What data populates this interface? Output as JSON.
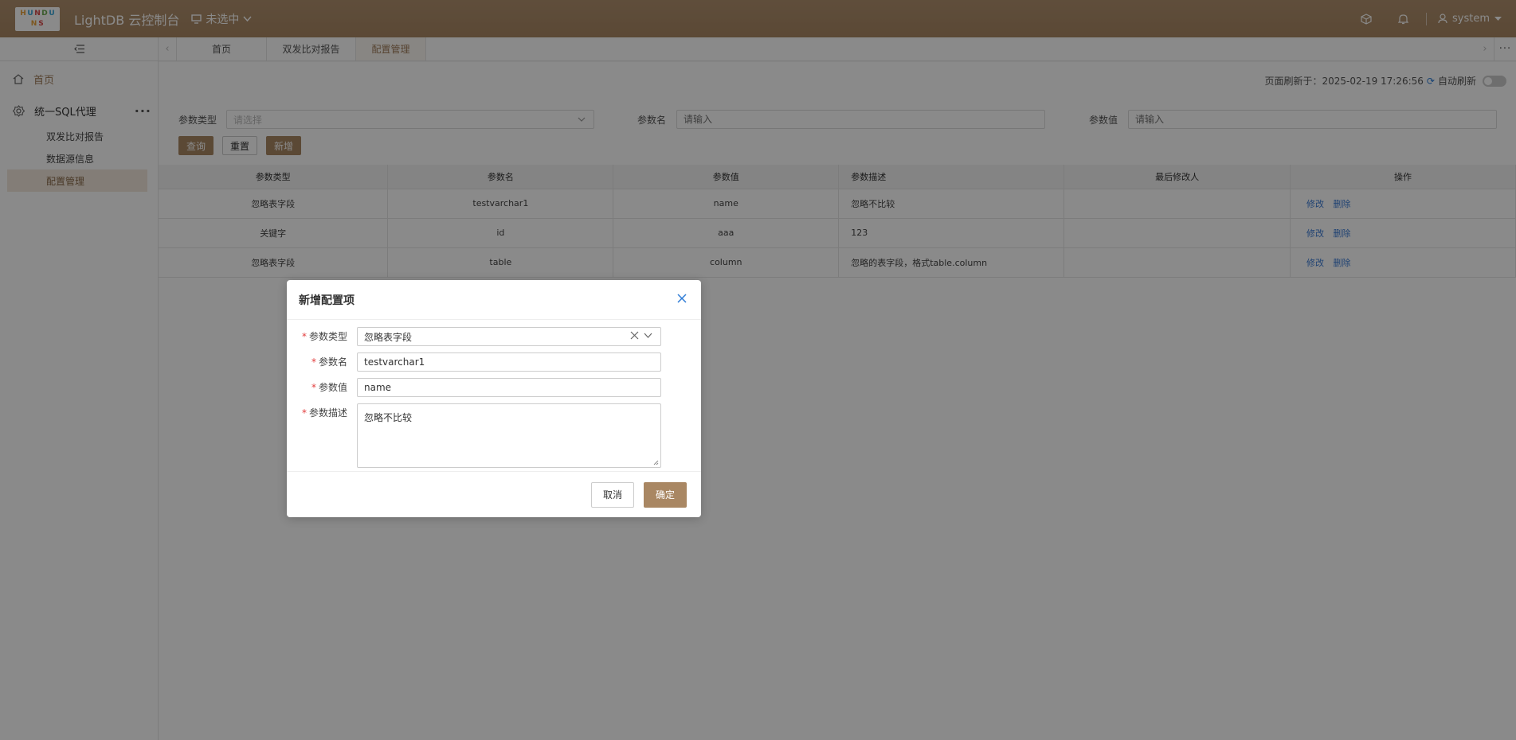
{
  "header": {
    "logo_letters": [
      "H",
      "U",
      "N",
      "D",
      "U",
      "N",
      "S"
    ],
    "app_title": "LightDB 云控制台",
    "env_select": "未选中",
    "user": "system",
    "icons": [
      "box-icon",
      "bell-icon",
      "user-icon"
    ]
  },
  "sidebar": {
    "home": "首页",
    "group": "统一SQL代理",
    "items": [
      {
        "label": "双发比对报告"
      },
      {
        "label": "数据源信息"
      },
      {
        "label": "配置管理"
      }
    ]
  },
  "tabs": [
    {
      "label": "首页"
    },
    {
      "label": "双发比对报告"
    },
    {
      "label": "配置管理"
    }
  ],
  "main": {
    "refresh_label": "页面刷新于：2025-02-19 17:26:56",
    "auto_refresh_label": "自动刷新",
    "filters": {
      "param_type_label": "参数类型",
      "param_type_placeholder": "请选择",
      "param_name_label": "参数名",
      "param_name_placeholder": "请输入",
      "param_value_label": "参数值",
      "param_value_placeholder": "请输入"
    },
    "buttons": {
      "query": "查询",
      "reset": "重置",
      "add": "新增"
    },
    "table": {
      "columns": [
        "参数类型",
        "参数名",
        "参数值",
        "参数描述",
        "最后修改人",
        "操作"
      ],
      "rows": [
        [
          "忽略表字段",
          "testvarchar1",
          "name",
          "忽略不比较",
          "",
          ""
        ],
        [
          "关键字",
          "id",
          "aaa",
          "123",
          "",
          ""
        ],
        [
          "忽略表字段",
          "table",
          "column",
          "忽略的表字段，格式table.column",
          "",
          ""
        ]
      ],
      "op_edit": "修改",
      "op_delete": "删除"
    }
  },
  "modal": {
    "title": "新增配置项",
    "fields": {
      "type_label": "参数类型",
      "type_value": "忽略表字段",
      "name_label": "参数名",
      "name_value": "testvarchar1",
      "value_label": "参数值",
      "value_value": "name",
      "desc_label": "参数描述",
      "desc_value": "忽略不比较"
    },
    "required_mark": "*",
    "cancel": "取消",
    "ok": "确定"
  },
  "colors": {
    "brand": "#a98763",
    "link": "#3a7bd5",
    "required": "#e23d3d"
  }
}
